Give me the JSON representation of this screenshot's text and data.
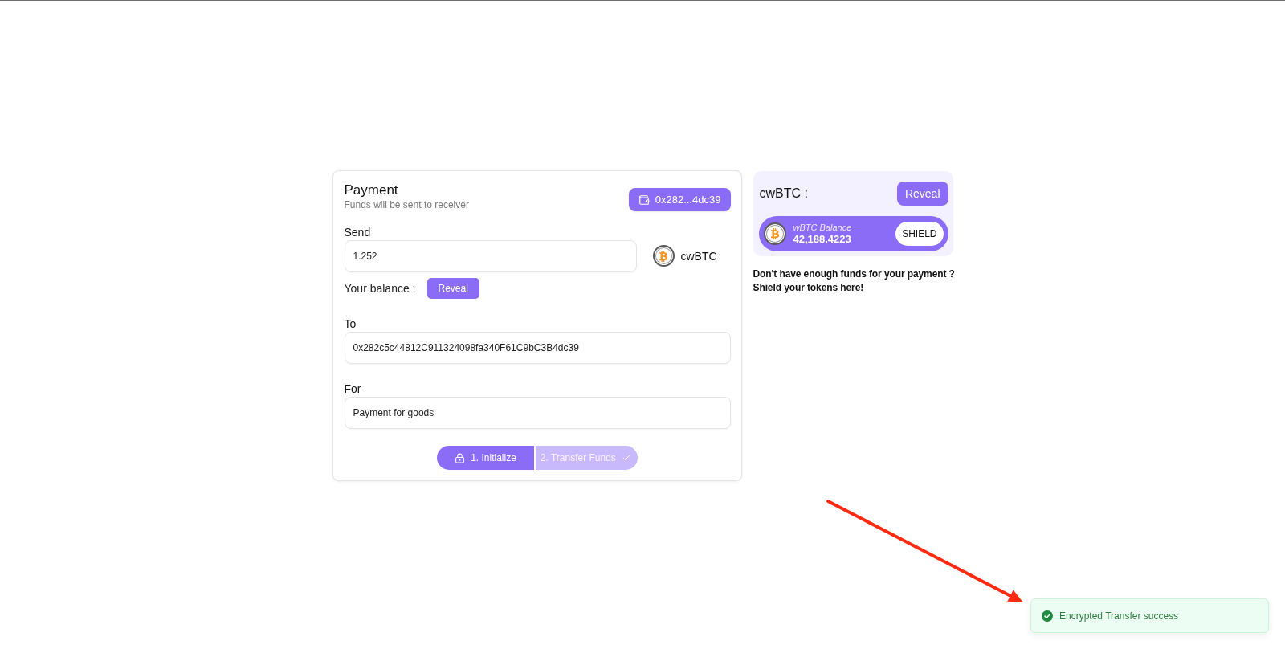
{
  "payment": {
    "title": "Payment",
    "subtitle": "Funds will be sent to receiver",
    "wallet_button": "0x282...4dc39",
    "send": {
      "label": "Send",
      "value": "1.252",
      "token": "cwBTC"
    },
    "balance": {
      "label": "Your balance :",
      "button": "Reveal"
    },
    "to": {
      "label": "To",
      "value": "0x282c5c44812C911324098fa340F61C9bC3B4dc39"
    },
    "for": {
      "label": "For",
      "value": "Payment for goods"
    },
    "steps": [
      {
        "label": "1. Initialize",
        "disabled": false
      },
      {
        "label": "2. Transfer Funds",
        "disabled": true
      }
    ]
  },
  "shield_panel": {
    "token": "cwBTC :",
    "reveal_button": "Reveal",
    "balance_label": "wBTC Balance",
    "balance_amount": "42,188.4223",
    "shield_button": "SHIELD",
    "note": [
      "Don't have enough funds for your payment ?",
      "Shield your tokens here!"
    ]
  },
  "toast": {
    "kind": "success",
    "message": "Encrypted Transfer success"
  }
}
